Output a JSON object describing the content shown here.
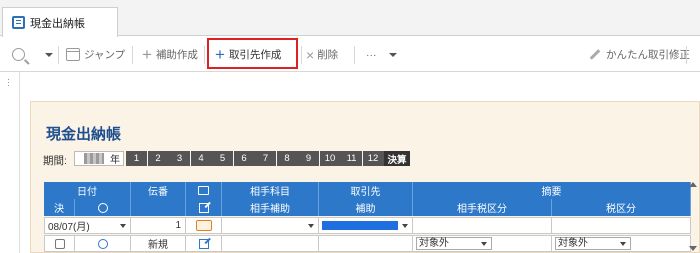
{
  "tab": {
    "label": "現金出納帳",
    "icon": "ledger-icon"
  },
  "toolbar": {
    "jump_label": "ジャンプ",
    "sub_create_label": "補助作成",
    "partner_create_label": "取引先作成",
    "delete_label": "削除",
    "more_label": "···",
    "kantan_label": "かんたん取引修正"
  },
  "page": {
    "title": "現金出納帳",
    "period_label": "期間:",
    "year_suffix": "年",
    "months": [
      "1",
      "2",
      "3",
      "4",
      "5",
      "6",
      "7",
      "8",
      "9",
      "10",
      "11",
      "12"
    ],
    "closing_label": "決算"
  },
  "grid": {
    "header_top": {
      "date": "日付",
      "voucher": "伝番",
      "account": "相手科目",
      "partner": "取引先",
      "summary": "摘要"
    },
    "header_bottom": {
      "settle": "決",
      "sub_account": "相手補助",
      "sub": "補助",
      "partner_tax": "相手税区分",
      "tax": "税区分"
    },
    "row1": {
      "date": "08/07(月)",
      "voucher": "1"
    },
    "row2": {
      "new_label": "新規",
      "partner_tax": "対象外",
      "tax": "対象外"
    }
  },
  "colors": {
    "header_blue": "#2d78c8",
    "highlight_red": "#e02020",
    "title_blue": "#1f4f8f",
    "panel_bg": "#fbf3e6"
  }
}
